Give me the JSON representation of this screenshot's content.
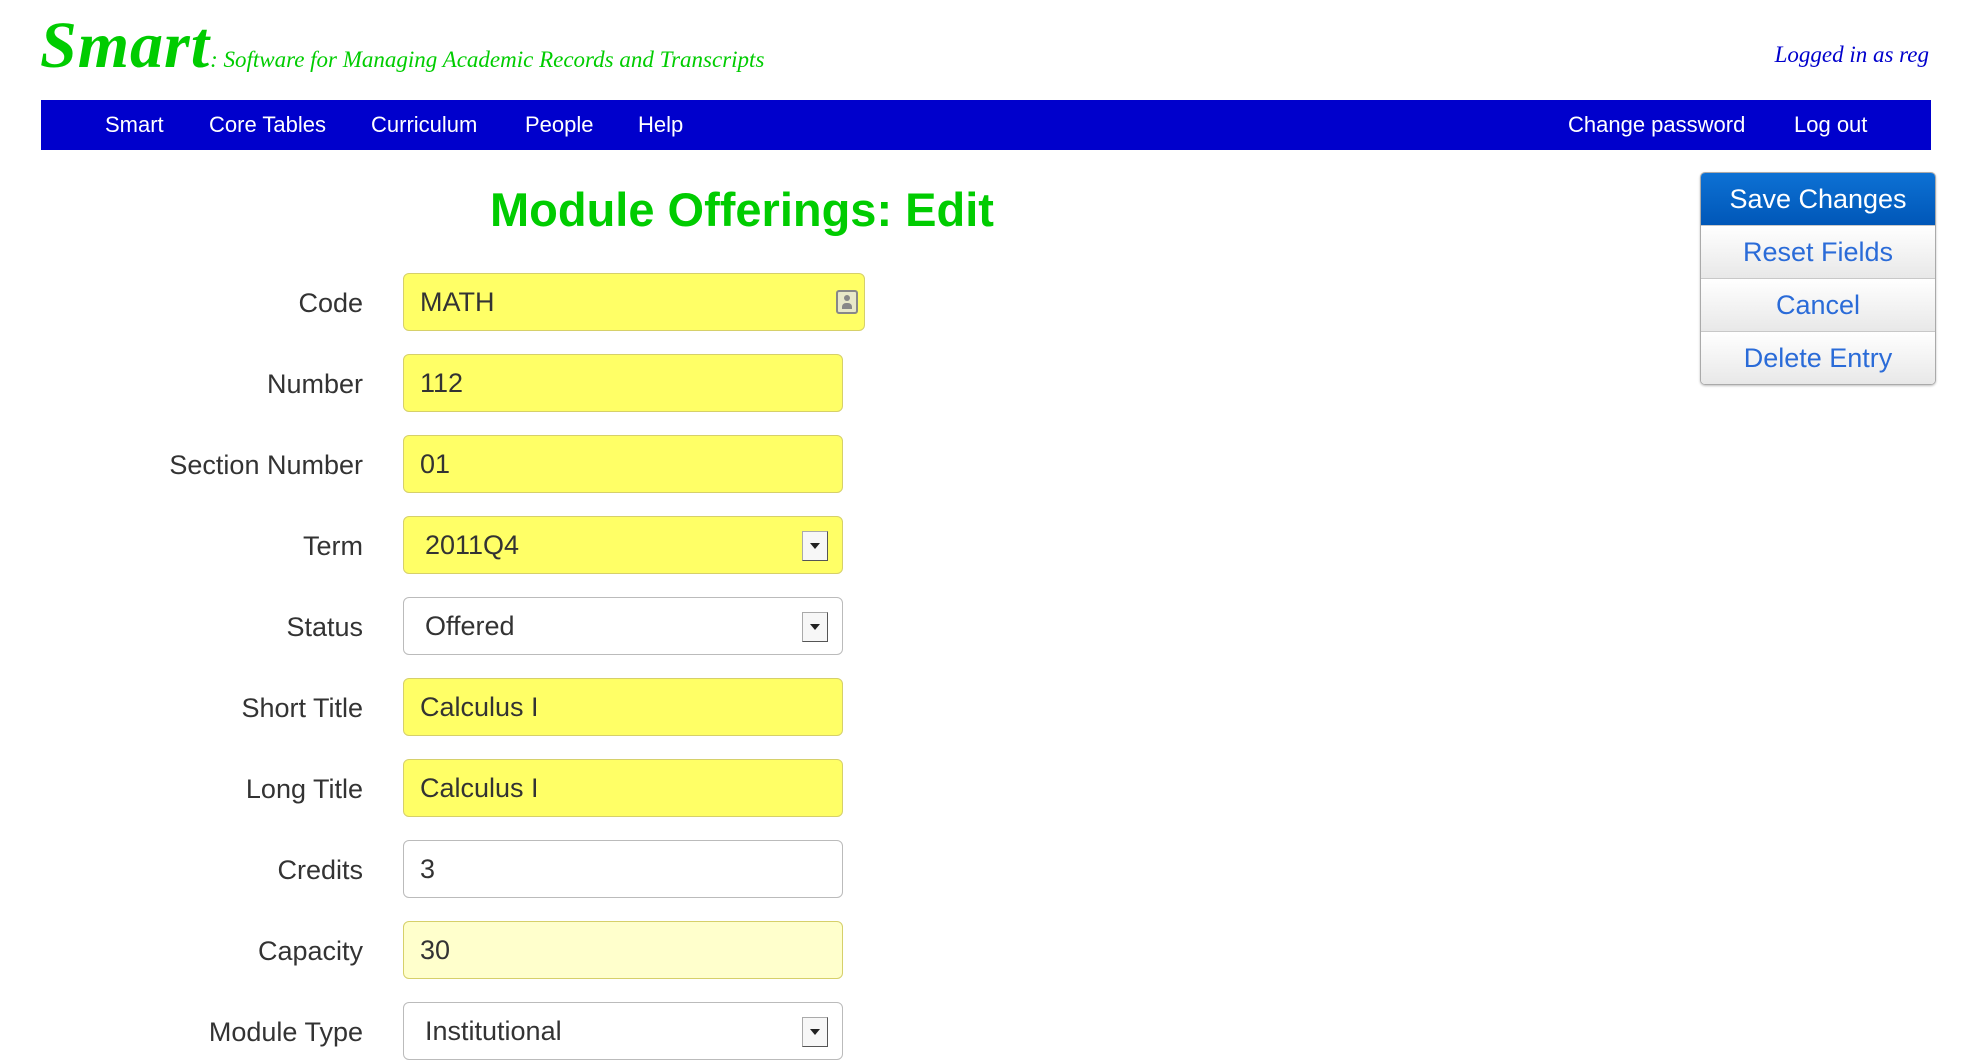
{
  "header": {
    "brand": "Smart",
    "tagline": ": Software for Managing Academic Records and Transcripts",
    "logged_in": "Logged in as reg"
  },
  "nav": {
    "left": [
      "Smart",
      "Core Tables",
      "Curriculum",
      "People",
      "Help"
    ],
    "right": [
      "Change password",
      "Log out"
    ]
  },
  "page": {
    "title": "Module Offerings: Edit"
  },
  "actions": {
    "save": "Save Changes",
    "reset": "Reset Fields",
    "cancel": "Cancel",
    "delete": "Delete Entry"
  },
  "form": {
    "code": {
      "label": "Code",
      "value": "MATH"
    },
    "number": {
      "label": "Number",
      "value": "112"
    },
    "section_number": {
      "label": "Section Number",
      "value": "01"
    },
    "term": {
      "label": "Term",
      "value": "2011Q4"
    },
    "status": {
      "label": "Status",
      "value": "Offered"
    },
    "short_title": {
      "label": "Short Title",
      "value": "Calculus I"
    },
    "long_title": {
      "label": "Long Title",
      "value": "Calculus I"
    },
    "credits": {
      "label": "Credits",
      "value": "3"
    },
    "capacity": {
      "label": "Capacity",
      "value": "30"
    },
    "module_type": {
      "label": "Module Type",
      "value": "Institutional"
    }
  },
  "colors": {
    "brand_green": "#00cc00",
    "nav_blue": "#0000cc",
    "required_field": "#ffff66",
    "optional_highlight": "#ffffcc",
    "primary_button": "#0066cc"
  }
}
